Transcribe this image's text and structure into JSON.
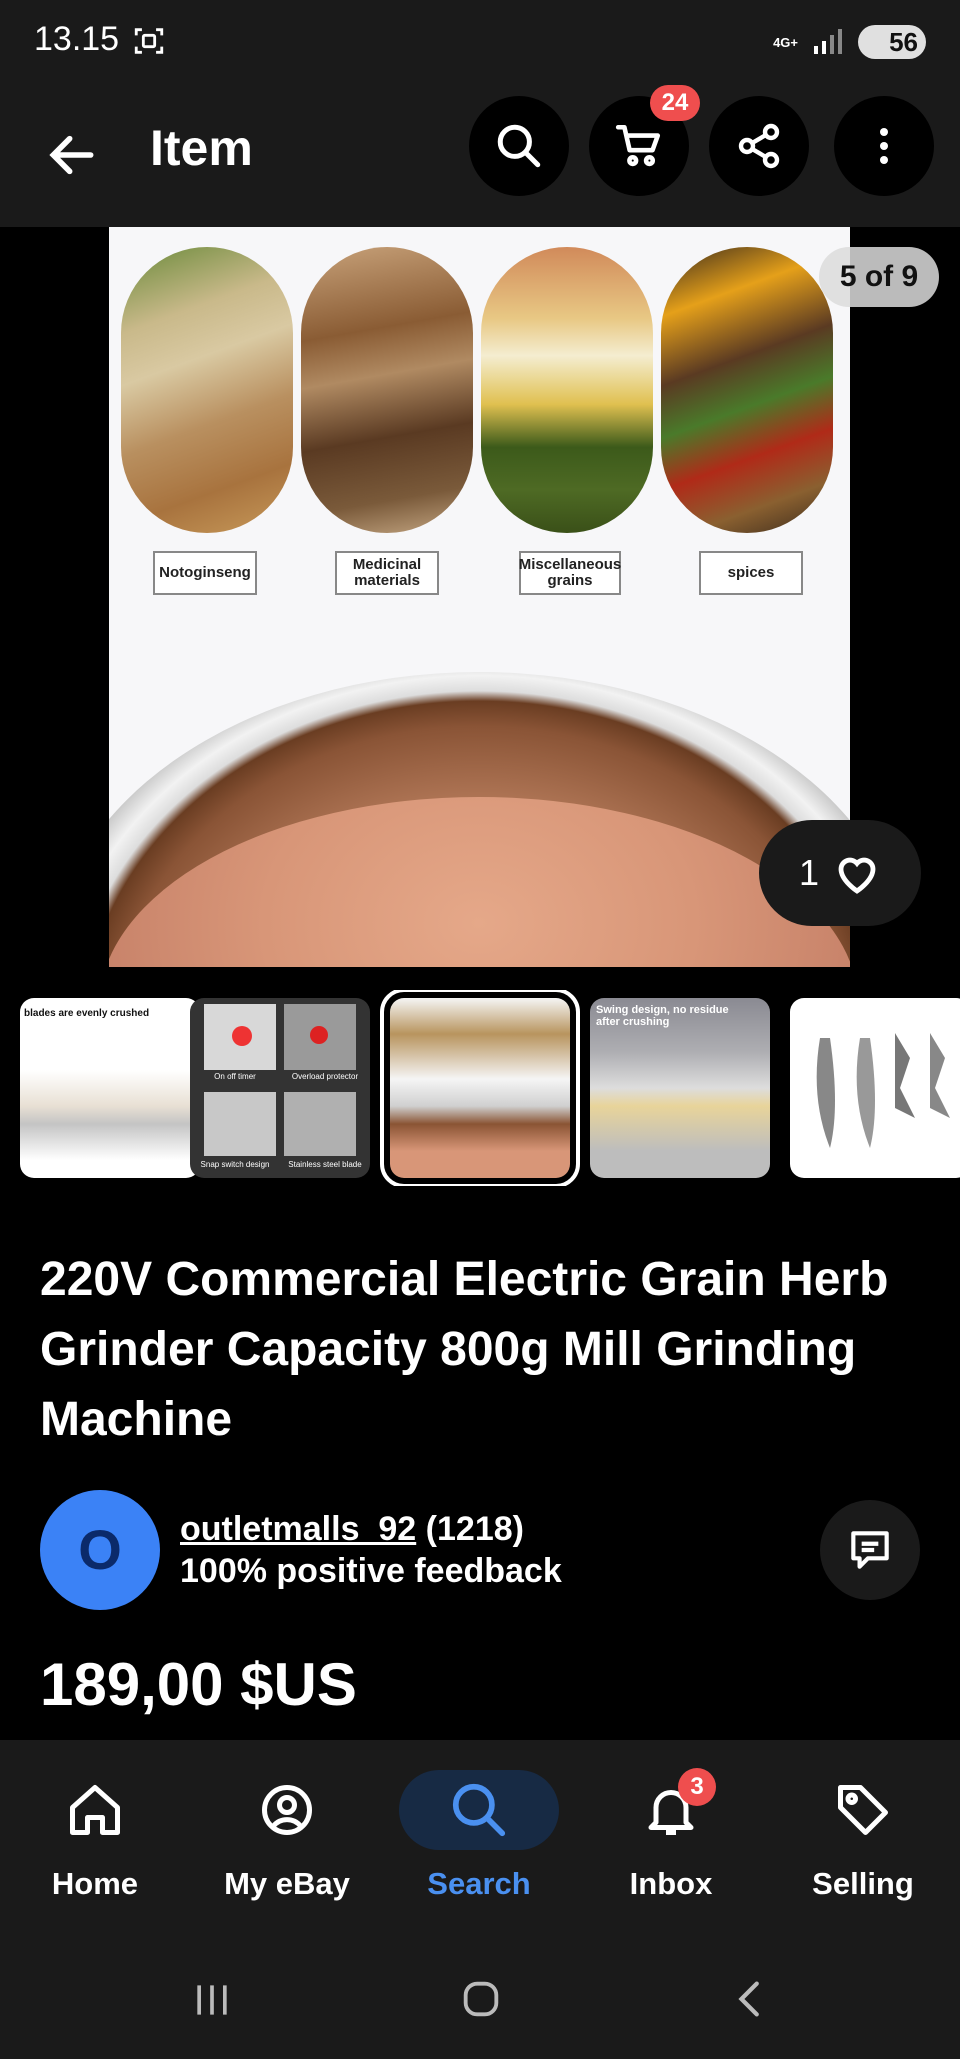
{
  "status": {
    "time": "13.15",
    "network": "4G+",
    "battery": "56"
  },
  "appbar": {
    "title": "Item",
    "cart_count": "24"
  },
  "gallery": {
    "counter": "5 of 9",
    "like_count": "1",
    "labels": [
      "Notoginseng",
      "Medicinal materials",
      "Miscellaneous grains",
      "spices"
    ],
    "thumb_texts": {
      "t1": "blades are evenly crushed",
      "t2_a": "On off timer",
      "t2_b": "Overload protector",
      "t2_c": "Snap switch design",
      "t2_d": "Stainless steel blade",
      "t4": "Swing design, no residue after crushing"
    }
  },
  "product": {
    "title": "220V Commercial Electric Grain Herb Grinder Capacity 800g Mill Grinding Machine",
    "price": "189,00 $US"
  },
  "seller": {
    "initial": "O",
    "name": "outletmalls_92",
    "count": "(1218)",
    "feedback": "100% positive feedback"
  },
  "bottom_nav": {
    "home": "Home",
    "myebay": "My eBay",
    "search": "Search",
    "inbox": "Inbox",
    "selling": "Selling",
    "inbox_badge": "3"
  },
  "colors": {
    "accent": "#4a90f0",
    "badge": "#ef4e4e",
    "avatar": "#3b82f6"
  }
}
